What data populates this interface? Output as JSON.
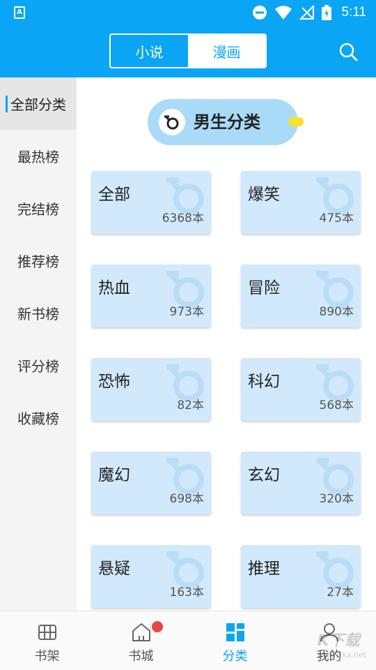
{
  "status_bar": {
    "time": "5:11",
    "app_badge": "A"
  },
  "header": {
    "tabs": [
      {
        "label": "小说",
        "active": false
      },
      {
        "label": "漫画",
        "active": true
      }
    ]
  },
  "sidebar": {
    "items": [
      {
        "label": "全部分类",
        "active": true
      },
      {
        "label": "最热榜"
      },
      {
        "label": "完结榜"
      },
      {
        "label": "推荐榜"
      },
      {
        "label": "新书榜"
      },
      {
        "label": "评分榜"
      },
      {
        "label": "收藏榜"
      }
    ]
  },
  "content": {
    "section_title": "男生分类",
    "categories": [
      {
        "name": "全部",
        "count": "6368本"
      },
      {
        "name": "爆笑",
        "count": "475本"
      },
      {
        "name": "热血",
        "count": "973本"
      },
      {
        "name": "冒险",
        "count": "890本"
      },
      {
        "name": "恐怖",
        "count": "82本"
      },
      {
        "name": "科幻",
        "count": "568本"
      },
      {
        "name": "魔幻",
        "count": "698本"
      },
      {
        "name": "玄幻",
        "count": "320本"
      },
      {
        "name": "悬疑",
        "count": "163本"
      },
      {
        "name": "推理",
        "count": "27本"
      }
    ]
  },
  "bottom_nav": {
    "items": [
      {
        "label": "书架",
        "icon": "bookshelf-icon"
      },
      {
        "label": "书城",
        "icon": "home-icon",
        "badge": true
      },
      {
        "label": "分类",
        "icon": "category-grid-icon",
        "active": true
      },
      {
        "label": "我的",
        "icon": "user-icon"
      }
    ]
  },
  "watermark": {
    "text": "K下载",
    "site": "www.kkx.net"
  },
  "colors": {
    "primary": "#0aa5f5",
    "card_bg": "#d1e9fb",
    "pill_bg": "#a9dbf8",
    "badge": "#e94343"
  }
}
